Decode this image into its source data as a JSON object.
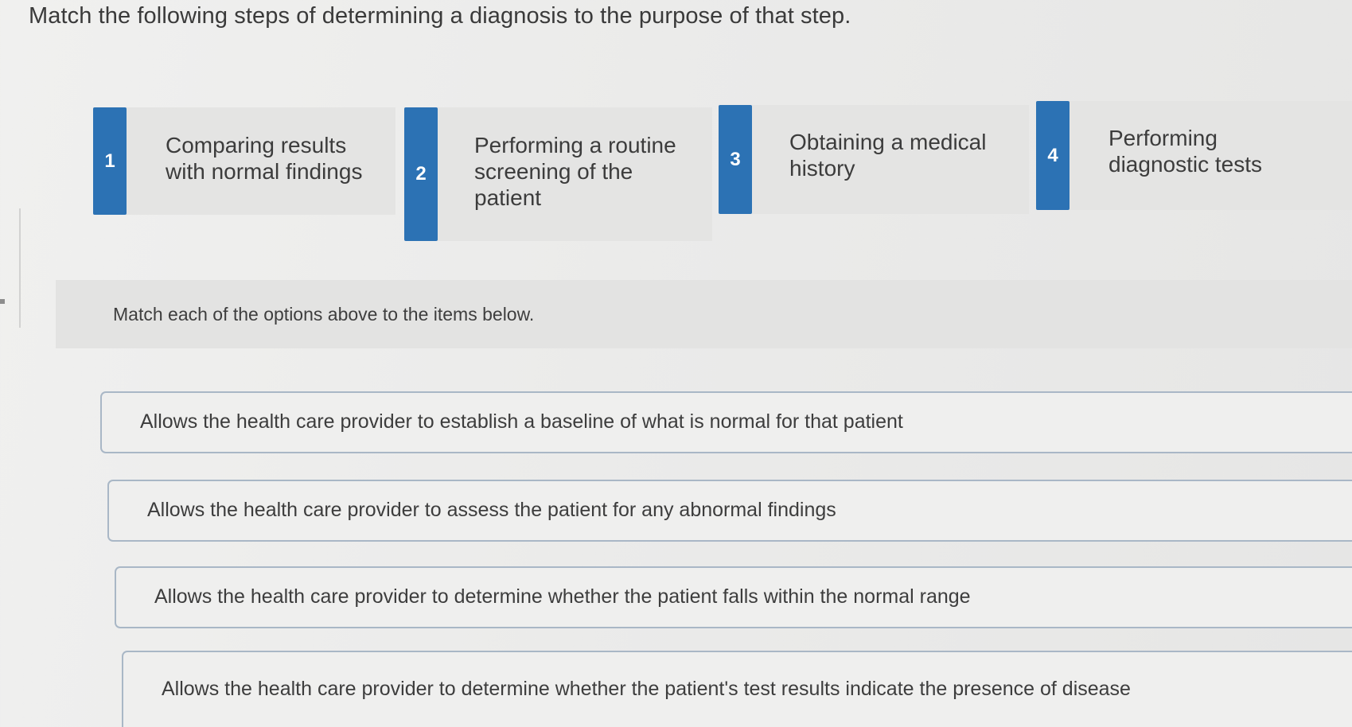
{
  "question": {
    "prompt": "Match the following steps of determining a diagnosis to the purpose of that step."
  },
  "options": [
    {
      "number": "1",
      "label": "Comparing results with normal findings"
    },
    {
      "number": "2",
      "label": "Performing a routine screening of the patient"
    },
    {
      "number": "3",
      "label": "Obtaining a medical history"
    },
    {
      "number": "4",
      "label": "Performing diagnostic tests"
    }
  ],
  "instructions": "Match each of the options above to the items below.",
  "targets": [
    {
      "text": "Allows the health care provider to establish a baseline of what is normal for that patient"
    },
    {
      "text": "Allows the health care provider to assess the patient for any abnormal findings"
    },
    {
      "text": "Allows the health care provider to determine whether the patient falls within the normal range"
    },
    {
      "text": "Allows the health care provider to determine whether the patient's test results indicate the presence of disease"
    }
  ],
  "colors": {
    "badge": "#2c72b4",
    "target_border": "#a9b7c6",
    "background": "#ebebea"
  }
}
